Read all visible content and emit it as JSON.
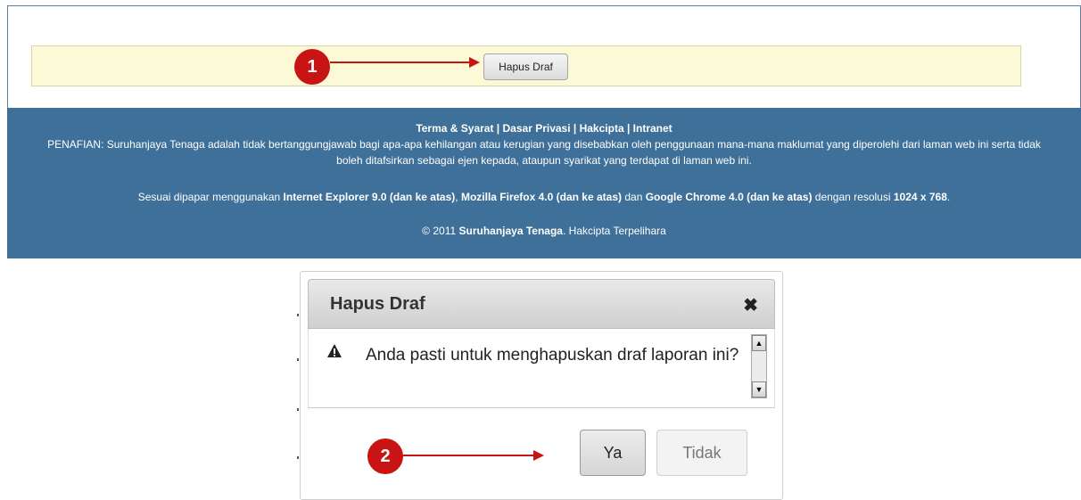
{
  "step1": {
    "callout_number": "1",
    "button_label": "Hapus Draf"
  },
  "footer": {
    "links": [
      "Terma & Syarat",
      "Dasar Privasi",
      "Hakcipta",
      "Intranet"
    ],
    "separator": " | ",
    "disclaimer": "PENAFIAN: Suruhanjaya Tenaga adalah tidak bertanggungjawab bagi apa-apa kehilangan atau kerugian yang disebabkan oleh penggunaan mana-mana maklumat yang diperolehi dari laman web ini serta tidak boleh ditafsirkan sebagai ejen kepada, ataupun syarikat yang terdapat di laman web ini.",
    "browsers_prefix": "Sesuai dipapar menggunakan ",
    "browser_ie": "Internet Explorer 9.0 (dan ke atas)",
    "browsers_sep1": ", ",
    "browser_firefox": "Mozilla Firefox 4.0 (dan ke atas)",
    "browsers_sep2": " dan ",
    "browser_chrome": "Google Chrome 4.0 (dan ke atas)",
    "browsers_mid": " dengan resolusi ",
    "resolution": "1024 x 768",
    "browsers_end": ".",
    "copyright_prefix": "© 2011 ",
    "copyright_org": "Suruhanjaya Tenaga",
    "copyright_suffix": ". Hakcipta Terpelihara"
  },
  "dialog": {
    "title": "Hapus Draf",
    "close_icon": "✖",
    "warning_icon": "warning-icon",
    "message": "Anda pasti untuk menghapuskan draf laporan ini?",
    "yes_label": "Ya",
    "no_label": "Tidak"
  },
  "step2": {
    "callout_number": "2"
  },
  "colors": {
    "callout": "#c81414",
    "footer_bg": "#3e7099",
    "action_bar_bg": "#fcf9d6"
  }
}
